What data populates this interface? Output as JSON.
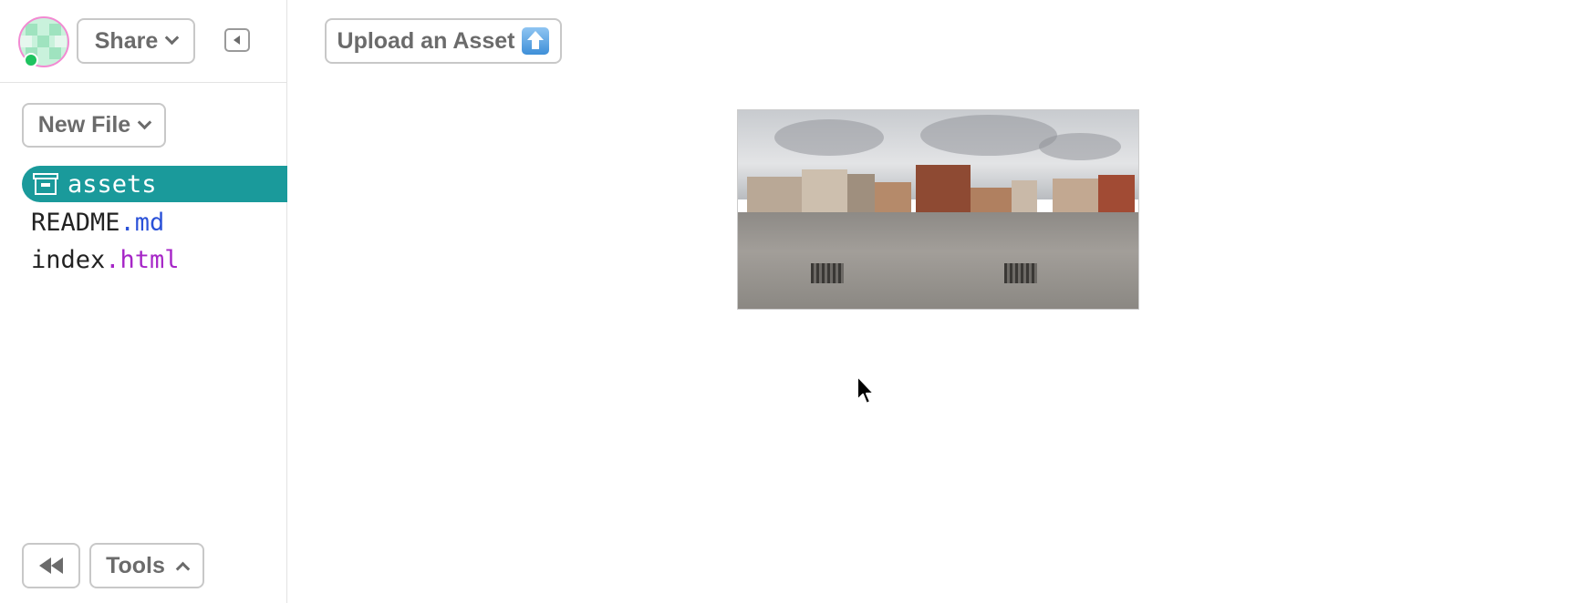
{
  "sidebar": {
    "share_label": "Share",
    "new_file_label": "New File",
    "files": [
      {
        "name": "assets",
        "ext": "",
        "type": "folder",
        "selected": true
      },
      {
        "name": "README",
        "ext": ".md",
        "type": "file",
        "selected": false
      },
      {
        "name": "index",
        "ext": ".html",
        "type": "file",
        "selected": false
      }
    ],
    "tools_label": "Tools"
  },
  "main": {
    "upload_label": "Upload an Asset",
    "upload_icon": "up-arrow-icon",
    "asset_image": "panorama-town-square"
  },
  "colors": {
    "selected_bg": "#1a9a9b",
    "md_ext": "#2b52d8",
    "html_ext": "#a626c7",
    "online": "#1ec35f",
    "avatar_border": "#f28ad2"
  }
}
